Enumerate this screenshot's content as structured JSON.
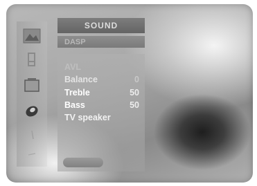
{
  "header": {
    "title": "SOUND",
    "subtitle": "DASP"
  },
  "sidebar": {
    "items": [
      {
        "icon": "picture-icon"
      },
      {
        "icon": "sound-icon"
      },
      {
        "icon": "time-icon"
      },
      {
        "icon": "option-icon"
      },
      {
        "icon": "lock-icon"
      },
      {
        "icon": "extra-icon"
      }
    ]
  },
  "menu": {
    "items": [
      {
        "label": "AVL",
        "value": ""
      },
      {
        "label": "Balance",
        "value": "0"
      },
      {
        "label": "Treble",
        "value": "50"
      },
      {
        "label": "Bass",
        "value": "50"
      },
      {
        "label": "TV speaker",
        "value": ""
      }
    ]
  }
}
